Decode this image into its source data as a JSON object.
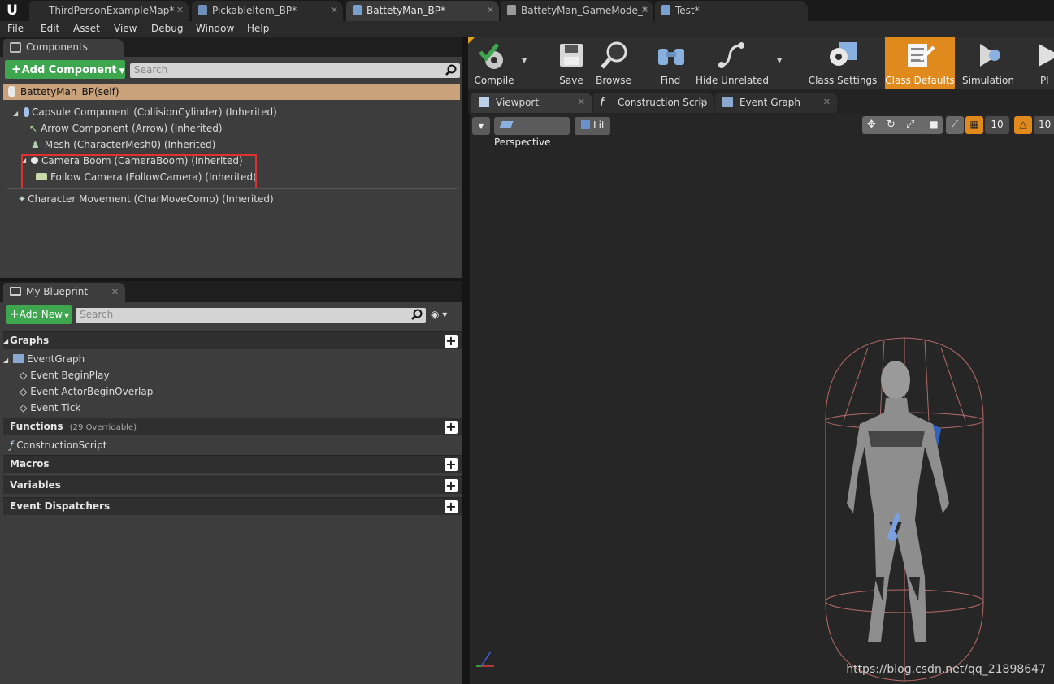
{
  "tabs": [
    {
      "label": "ThirdPersonExampleMap*"
    },
    {
      "label": "PickableItem_BP*"
    },
    {
      "label": "BattetyMan_BP*"
    },
    {
      "label": "BattetyMan_GameMode_*"
    },
    {
      "label": "Test*"
    }
  ],
  "logo": "U",
  "menu": [
    "File",
    "Edit",
    "Asset",
    "View",
    "Debug",
    "Window",
    "Help"
  ],
  "components": {
    "tab_label": "Components",
    "add_button": "Add Component",
    "search_placeholder": "Search",
    "self_row": "BattetyMan_BP(self)",
    "items": [
      "Capsule Component (CollisionCylinder) (Inherited)",
      "Arrow Component (Arrow) (Inherited)",
      "Mesh (CharacterMesh0) (Inherited)",
      "Camera Boom (CameraBoom) (Inherited)",
      "Follow Camera (FollowCamera) (Inherited)",
      "Character Movement (CharMoveComp) (Inherited)"
    ]
  },
  "blueprint": {
    "tab_label": "My Blueprint",
    "add_new": "Add New",
    "search_placeholder": "Search",
    "sections": {
      "graphs": "Graphs",
      "functions": "Functions",
      "functions_note": "(29 Overridable)",
      "macros": "Macros",
      "variables": "Variables",
      "dispatchers": "Event Dispatchers"
    },
    "event_graph": "EventGraph",
    "events": [
      "Event BeginPlay",
      "Event ActorBeginOverlap",
      "Event Tick"
    ],
    "construction_script": "ConstructionScript"
  },
  "toolbar": {
    "compile": "Compile",
    "save": "Save",
    "browse": "Browse",
    "find": "Find",
    "hide_unrelated": "Hide Unrelated",
    "class_settings": "Class Settings",
    "class_defaults": "Class Defaults",
    "simulation": "Simulation",
    "play": "Pl"
  },
  "editor_tabs": [
    "Viewport",
    "Construction Scrip",
    "Event Graph"
  ],
  "viewport": {
    "perspective": "Perspective",
    "lit": "Lit",
    "grid_snap": "10",
    "rot_snap": "10"
  },
  "watermark": "https://blog.csdn.net/qq_21898647",
  "colors": {
    "accent": "#e08a1e",
    "green": "#3da64f",
    "highlight_box": "#e03030",
    "selected_row": "#c9a27b"
  }
}
